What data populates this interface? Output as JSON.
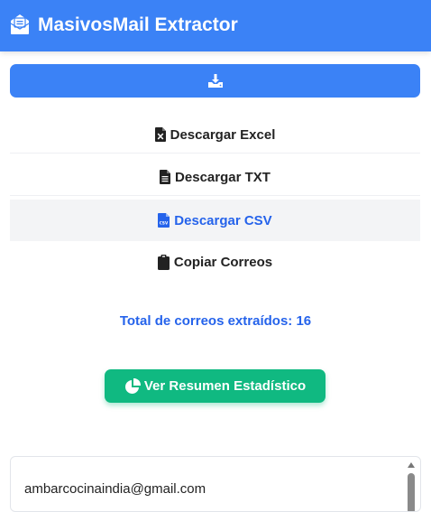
{
  "header": {
    "title": "MasivosMail Extractor",
    "logo_icon": "envelope-open-text-icon",
    "color": "#3b82f6"
  },
  "toolbar": {
    "download_icon": "download-icon"
  },
  "menu": {
    "items": [
      {
        "label": "Descargar Excel",
        "icon": "file-excel-icon"
      },
      {
        "label": "Descargar TXT",
        "icon": "file-lines-icon"
      },
      {
        "label": "Descargar CSV",
        "icon": "file-csv-icon",
        "active": true
      },
      {
        "label": "Copiar Correos",
        "icon": "clipboard-icon"
      }
    ]
  },
  "summary": {
    "total_text": "Total de correos extraídos: 16",
    "accent": "#2563eb"
  },
  "stats_button": {
    "label": "Ver Resumen Estadístico",
    "icon": "chart-pie-icon",
    "color": "#10b981"
  },
  "emails": {
    "visible": [
      "ambarcocinaindia@gmail.com"
    ]
  }
}
